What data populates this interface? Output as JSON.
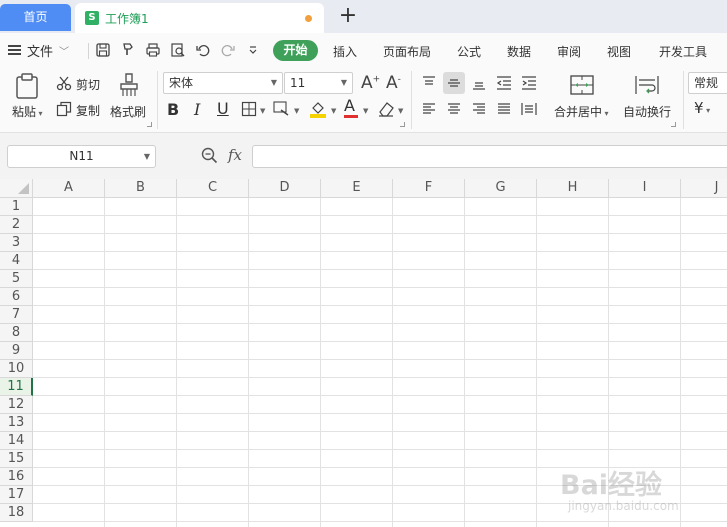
{
  "tabs": {
    "home": "首页",
    "workbook": "工作簿1",
    "workbook_icon": "S"
  },
  "menu": {
    "file": "文件",
    "items": [
      "开始",
      "插入",
      "页面布局",
      "公式",
      "数据",
      "审阅",
      "视图",
      "开发工具"
    ]
  },
  "ribbon": {
    "paste": "粘贴",
    "cut": "剪切",
    "copy": "复制",
    "format_painter": "格式刷",
    "font_name": "宋体",
    "font_size": "11",
    "merge_center": "合并居中",
    "wrap_text": "自动换行",
    "number_format": "常规",
    "currency_symbol": "¥",
    "font_color": "#e03030",
    "fill_color": "#f5d300"
  },
  "formula_bar": {
    "name_box": "N11",
    "fx": "fx",
    "formula": ""
  },
  "grid": {
    "columns": [
      "A",
      "B",
      "C",
      "D",
      "E",
      "F",
      "G",
      "H",
      "I",
      "J"
    ],
    "rows": [
      "1",
      "2",
      "3",
      "4",
      "5",
      "6",
      "7",
      "8",
      "9",
      "10",
      "11",
      "12",
      "13",
      "14",
      "15",
      "16",
      "17",
      "18"
    ],
    "selected_row": "11"
  },
  "watermark": {
    "text": "Bai经验",
    "url": "jingyan.baidu.com"
  },
  "colors": {
    "accent_blue": "#4f8df5",
    "accent_green": "#3fa05a",
    "selection_green": "#217346"
  }
}
